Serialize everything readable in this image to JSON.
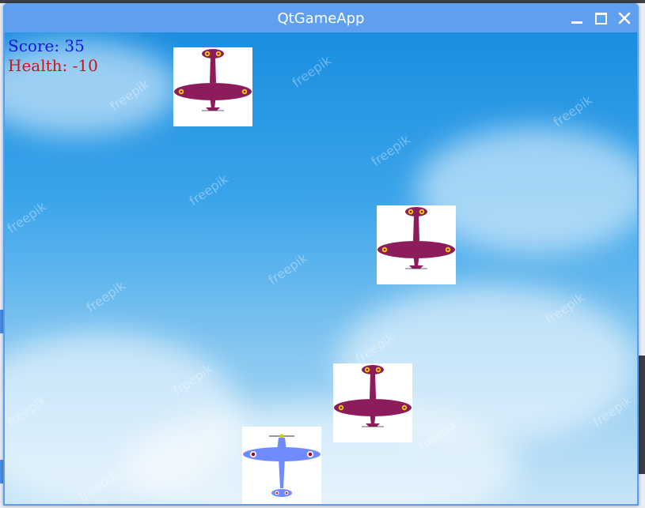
{
  "window": {
    "title": "QtGameApp",
    "controls": [
      "minimize",
      "maximize",
      "close"
    ]
  },
  "hud": {
    "score_text": "Score: 35",
    "health_text": "Health: -10",
    "score_color": "#1515d8",
    "health_color": "#c8151c"
  },
  "sprites": {
    "enemy": {
      "name": "enemy-plane",
      "body_color": "#8c1c5c",
      "roundel_color": "#f0d000"
    },
    "player": {
      "name": "player-plane",
      "body_color": "#6e8cff",
      "roundel_color": "#c0102c"
    }
  },
  "watermark": "freepik",
  "colors": {
    "titlebar": "#5f9ff0",
    "sky": "#3aa4ea"
  }
}
